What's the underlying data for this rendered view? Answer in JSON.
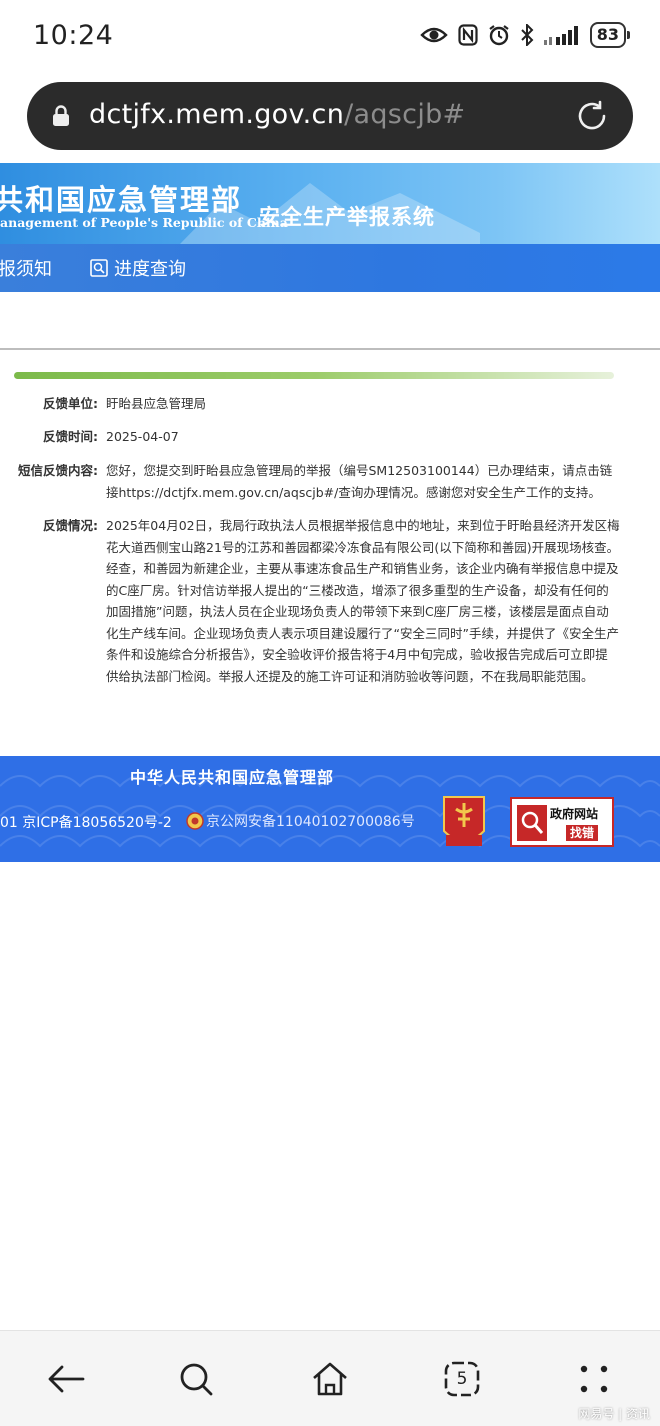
{
  "status": {
    "time": "10:24",
    "battery": "83"
  },
  "browser": {
    "url_domain": "dctjfx.mem.gov.cn",
    "url_path": "/aqscjb#",
    "tab_count": "5"
  },
  "header": {
    "ministry_cn": "共和国应急管理部",
    "ministry_en": "anagement of People's Republic of China",
    "system_title": "安全生产举报系统"
  },
  "nav": {
    "items": [
      {
        "label": "报须知"
      },
      {
        "label": "进度查询"
      }
    ]
  },
  "feedback": {
    "unit_label": "反馈单位:",
    "unit_value": "盱眙县应急管理局",
    "time_label": "反馈时间:",
    "time_value": "2025-04-07",
    "sms_label": "短信反馈内容:",
    "sms_value": "您好，您提交到盱眙县应急管理局的举报（编号SM12503100144）已办理结束，请点击链接https://dctjfx.mem.gov.cn/aqscjb#/查询办理情况。感谢您对安全生产工作的支持。",
    "status_label": "反馈情况:",
    "status_value": "2025年04月02日，我局行政执法人员根据举报信息中的地址，来到位于盱眙县经济开发区梅花大道西侧宝山路21号的江苏和善园都梁冷冻食品有限公司(以下简称和善园)开展现场核查。经查，和善园为新建企业，主要从事速冻食品生产和销售业务，该企业内确有举报信息中提及的C座厂房。针对信访举报人提出的“三楼改造，增添了很多重型的生产设备，却没有任何的加固措施”问题，执法人员在企业现场负责人的带领下来到C座厂房三楼，该楼层是面点自动化生产线车间。企业现场负责人表示项目建设履行了“安全三同时”手续，并提供了《安全生产条件和设施综合分析报告》，安全验收评价报告将于4月中旬完成，验收报告完成后可立即提供给执法部门检阅。举报人还提及的施工许可证和消防验收等问题，不在我局职能范围。"
  },
  "footer": {
    "title": "中华人民共和国应急管理部",
    "icp": "01  京ICP备18056520号-2",
    "police": "京公网安备11040102700086号",
    "party_badge": "党政机关",
    "govsite_line1": "政府网站",
    "govsite_line2": "找错"
  },
  "watermark": "网易号 | 资讯",
  "colors": {
    "header_blue": "#2f8ee0",
    "footer_blue": "#2f6fe6",
    "green_accent": "#7cba4a",
    "url_bar": "#2b2b2b"
  }
}
